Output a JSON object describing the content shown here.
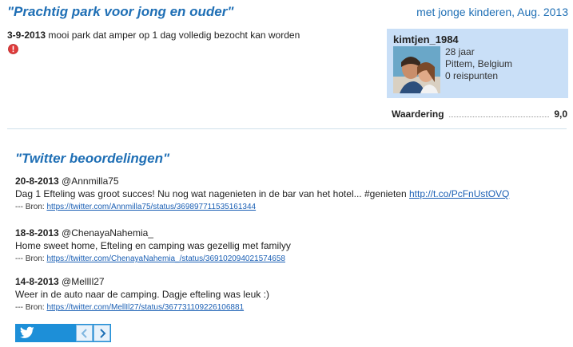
{
  "review": {
    "title": "\"Prachtig park voor jong en ouder\"",
    "meta": "met jonge kinderen, Aug. 2013",
    "date": "3-9-2013",
    "text": " mooi park dat amper op 1 dag volledig bezocht kan worden"
  },
  "profile": {
    "username": "kimtjen_1984",
    "age": "28 jaar",
    "location": "Pittem, Belgium",
    "points": "0 reispunten"
  },
  "rating": {
    "label": "Waardering",
    "value": "9,0"
  },
  "twitter": {
    "title": "\"Twitter beoordelingen\"",
    "source_label": "--- Bron: ",
    "tweets": [
      {
        "date": "20-8-2013",
        "handle": " @Annmilla75",
        "text": "Dag 1 Efteling was groot succes! Nu nog wat nagenieten in de bar van het hotel... #genieten ",
        "link": "http://t.co/PcFnUstOVQ",
        "source": "https://twitter.com/Annmilla75/status/369897711535161344"
      },
      {
        "date": "18-8-2013",
        "handle": " @ChenayaNahemia_",
        "text": "Home sweet home, Efteling en camping was gezellig met familyy",
        "link": "",
        "source": "https://twitter.com/ChenayaNahemia_/status/369102094021574658"
      },
      {
        "date": "14-8-2013",
        "handle": " @MellIl27",
        "text": "Weer in de auto naar de camping. Dagje efteling was leuk :)",
        "link": "",
        "source": "https://twitter.com/MellIl27/status/367731109226106881"
      }
    ]
  },
  "icons": {
    "alert": "alert-icon",
    "twitter": "twitter-bird-icon",
    "prev": "chevron-left-icon",
    "next": "chevron-right-icon"
  },
  "colors": {
    "accent": "#1f6fb5",
    "profile_bg": "#c9dff7",
    "twitter_blue": "#1d8fd8",
    "alert_red": "#e03c3c"
  }
}
